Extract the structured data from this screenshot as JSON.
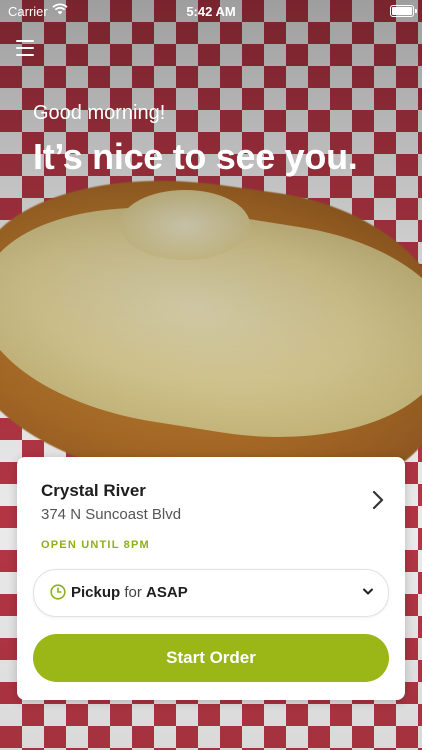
{
  "status_bar": {
    "carrier": "Carrier",
    "time": "5:42 AM",
    "icons": [
      "wifi-icon",
      "battery-icon"
    ]
  },
  "header": {
    "menu_icon": "hamburger-menu-icon",
    "greeting": "Good morning!",
    "headline": "It’s nice to see you."
  },
  "store": {
    "name": "Crystal River",
    "address": "374 N Suncoast Blvd",
    "hours_status": "OPEN UNTIL 8PM",
    "chevron_icon": "chevron-right-icon"
  },
  "order_type": {
    "mode": "Pickup",
    "connector": "for",
    "time": "ASAP",
    "icons": [
      "clock-icon",
      "chevron-down-icon"
    ]
  },
  "cta": {
    "label": "Start Order"
  },
  "colors": {
    "accent": "#9ab617",
    "open_status": "#8db01a",
    "checker_red": "#c23a4a"
  }
}
